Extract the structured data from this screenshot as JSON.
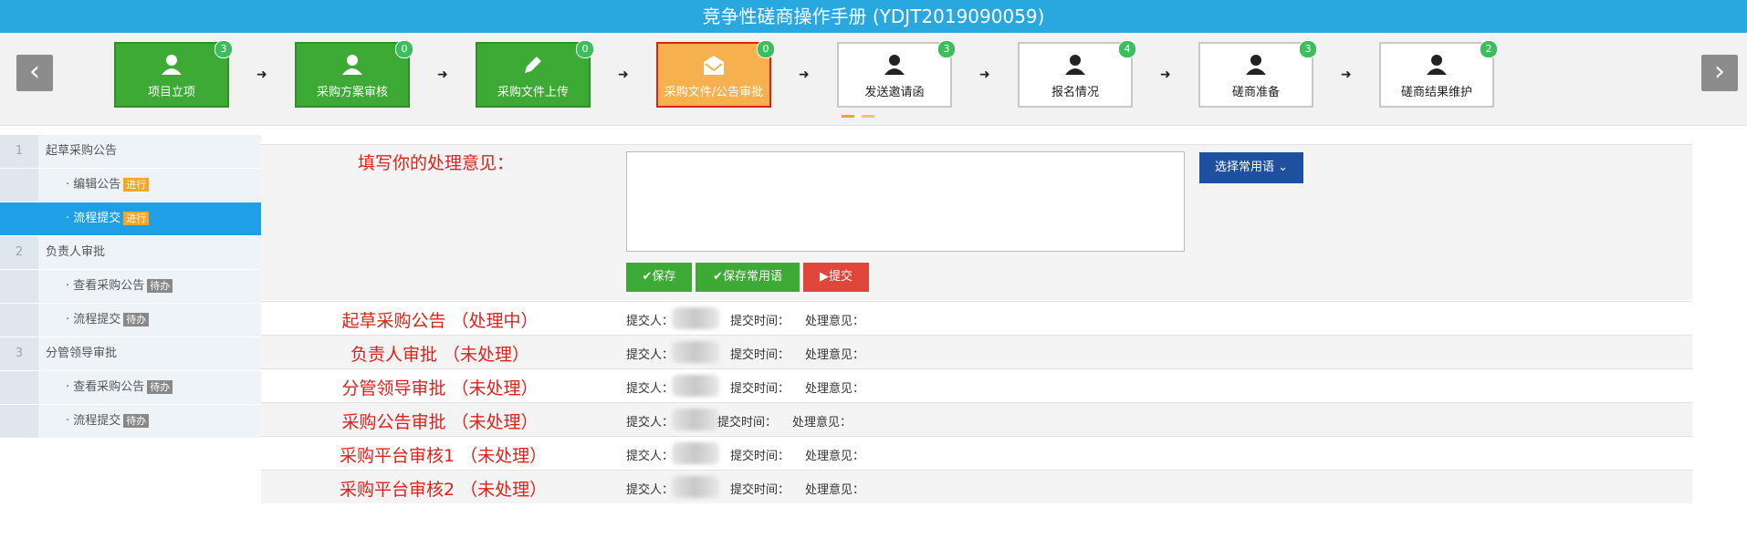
{
  "title": "竞争性磋商操作手册 (YDJT2019090059)",
  "nav": {
    "prev": "‹",
    "next": "›"
  },
  "steps": [
    {
      "label": "项目立项",
      "badge": "3",
      "state": "done",
      "icon": "user-icon"
    },
    {
      "label": "采购方案审核",
      "badge": "0",
      "state": "done",
      "icon": "user-icon"
    },
    {
      "label": "采购文件上传",
      "badge": "0",
      "state": "done",
      "icon": "pencil-icon"
    },
    {
      "label": "采购文件/公告审批",
      "badge": "0",
      "state": "active",
      "icon": "envelope-icon"
    },
    {
      "label": "发送邀请函",
      "badge": "3",
      "state": "pending",
      "icon": "user-icon"
    },
    {
      "label": "报名情况",
      "badge": "4",
      "state": "pending",
      "icon": "user-icon"
    },
    {
      "label": "磋商准备",
      "badge": "3",
      "state": "pending",
      "icon": "user-icon"
    },
    {
      "label": "磋商结果维护",
      "badge": "2",
      "state": "pending",
      "icon": "user-icon"
    }
  ],
  "sidebar": {
    "items": [
      {
        "num": "1",
        "label": "起草采购公告"
      },
      {
        "label": "· 编辑公告",
        "tag": "进行"
      },
      {
        "label": "· 流程提交",
        "tag": "进行"
      },
      {
        "num": "2",
        "label": "负责人审批"
      },
      {
        "label": "· 查看采购公告",
        "tag": "待办"
      },
      {
        "label": "· 流程提交",
        "tag": "待办"
      },
      {
        "num": "3",
        "label": "分管领导审批"
      },
      {
        "label": "· 查看采购公告",
        "tag": "待办"
      },
      {
        "label": "· 流程提交",
        "tag": "待办"
      }
    ]
  },
  "form": {
    "opinion_label": "填写你的处理意见：",
    "opinion_value": "",
    "phrase_button": "选择常用语",
    "save": "保存",
    "save_phrase": "保存常用语",
    "submit": "提交"
  },
  "records": [
    {
      "title": "起草采购公告 （处理中）"
    },
    {
      "title": "负责人审批 （未处理）"
    },
    {
      "title": "分管领导审批 （未处理）"
    },
    {
      "title": "采购公告审批 （未处理）"
    },
    {
      "title": "采购平台审核1 （未处理）"
    },
    {
      "title": "采购平台审核2 （未处理）"
    }
  ],
  "record_fields": {
    "submitter": "提交人：",
    "time": "提交时间：",
    "opinion": "处理意见："
  },
  "colors": {
    "header": "#29a8e0",
    "done": "#3daa35",
    "active": "#f6b04e",
    "selected": "#1e9fe6",
    "alert": "#e0201b"
  }
}
